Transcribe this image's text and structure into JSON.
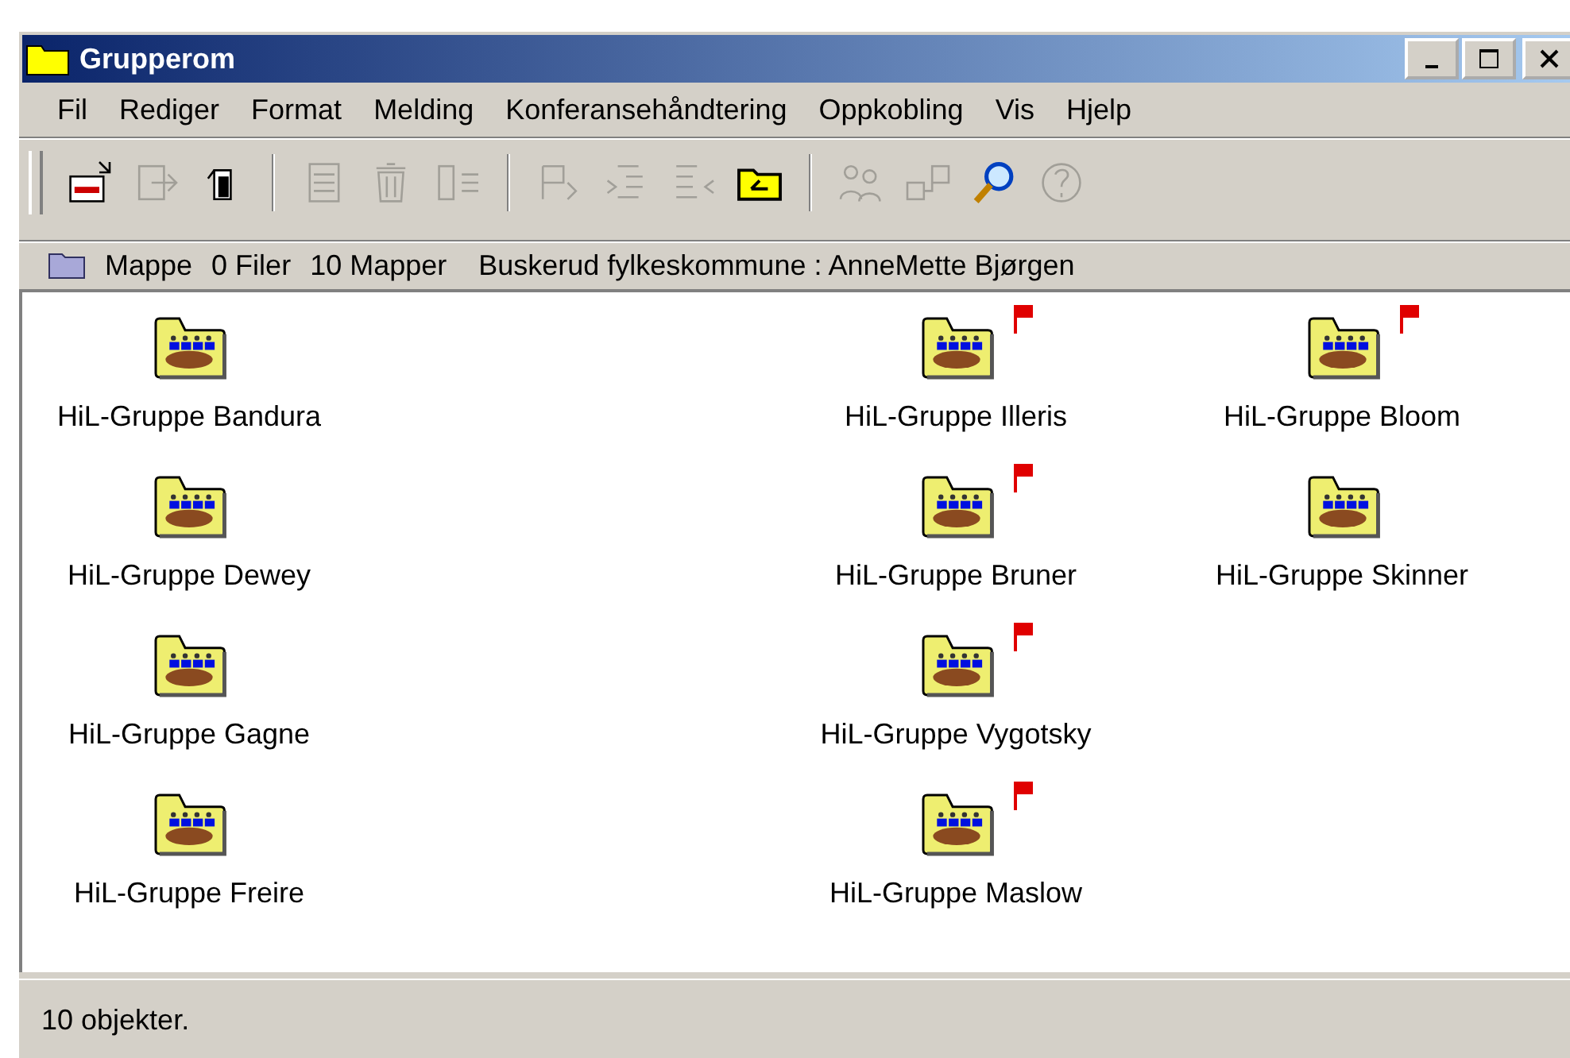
{
  "window": {
    "title": "Grupperom"
  },
  "menu": [
    "Fil",
    "Rediger",
    "Format",
    "Melding",
    "Konferansehåndtering",
    "Oppkobling",
    "Vis",
    "Hjelp"
  ],
  "toolbar_groups": [
    {
      "tools": [
        {
          "kind": "compose",
          "disabled": false
        },
        {
          "kind": "reply",
          "disabled": true
        },
        {
          "kind": "page",
          "disabled": false
        }
      ]
    },
    {
      "tools": [
        {
          "kind": "list",
          "disabled": true
        },
        {
          "kind": "trash",
          "disabled": true
        },
        {
          "kind": "split",
          "disabled": true
        }
      ]
    },
    {
      "tools": [
        {
          "kind": "flag",
          "disabled": true
        },
        {
          "kind": "indent",
          "disabled": true
        },
        {
          "kind": "outdent",
          "disabled": true
        },
        {
          "kind": "folder",
          "disabled": false
        }
      ]
    },
    {
      "tools": [
        {
          "kind": "link",
          "disabled": true
        },
        {
          "kind": "unlink",
          "disabled": true
        },
        {
          "kind": "search",
          "disabled": false
        },
        {
          "kind": "help",
          "disabled": true
        }
      ]
    }
  ],
  "path_bar": {
    "type": "Mappe",
    "files": "0 Filer",
    "folders": "10 Mapper",
    "location": "Buskerud fylkeskommune : AnneMette Bjørgen"
  },
  "folder_columns": [
    {
      "folders": [
        {
          "name": "HiL-Gruppe Bandura",
          "flagged": false
        },
        {
          "name": "HiL-Gruppe Dewey",
          "flagged": false
        },
        {
          "name": "HiL-Gruppe Gagne",
          "flagged": false
        },
        {
          "name": "HiL-Gruppe Freire",
          "flagged": false
        }
      ]
    },
    {
      "folders": [
        {
          "name": "HiL-Gruppe Illeris",
          "flagged": true
        },
        {
          "name": "HiL-Gruppe Bruner",
          "flagged": true
        },
        {
          "name": "HiL-Gruppe Vygotsky",
          "flagged": true
        },
        {
          "name": "HiL-Gruppe Maslow",
          "flagged": true
        }
      ]
    },
    {
      "folders": [
        {
          "name": "HiL-Gruppe Bloom",
          "flagged": true
        },
        {
          "name": "HiL-Gruppe Skinner",
          "flagged": false
        }
      ]
    }
  ],
  "status_bar": "10 objekter."
}
